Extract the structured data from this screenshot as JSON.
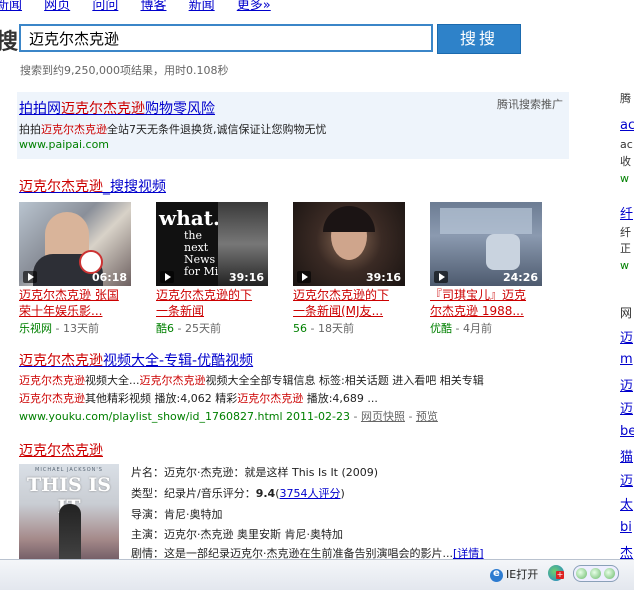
{
  "nav": [
    "新闻",
    "网页",
    "问问",
    "博客",
    "新闻",
    "更多»"
  ],
  "search": {
    "logo_char": "搜",
    "query": "迈克尔杰克逊",
    "button": "搜搜",
    "stats": "搜索到约9,250,000项结果，用时0.108秒"
  },
  "ad": {
    "title_pre": "拍拍网",
    "title_hl": "迈克尔杰克逊",
    "title_post": "购物零风险",
    "tag": "腾讯搜索推广",
    "desc_pre": "拍拍",
    "desc_hl": "迈克尔杰克逊",
    "desc_post": "全站7天无条件退换货,诚信保证让您购物无忧",
    "url": "www.paipai.com"
  },
  "video": {
    "title_hl": "迈克尔杰克逊",
    "title_post": "_搜搜视频",
    "items": [
      {
        "duration": "06:18",
        "cap1": "迈克尔杰克逊 张国",
        "cap2": "荣十年娱乐影...",
        "source": "乐视网",
        "age": " - 13天前"
      },
      {
        "duration": "39:16",
        "cap1": "迈克尔杰克逊的下",
        "cap2": "一条新闻",
        "source": "酷6",
        "age": " - 25天前"
      },
      {
        "duration": "39:16",
        "cap1": "迈克尔杰克逊的下",
        "cap2": "一条新闻(MJ友...",
        "source": "56",
        "age": " - 18天前"
      },
      {
        "duration": "24:26",
        "cap1": "『司琪宝儿』迈克",
        "cap2": "尔杰克逊  1988...",
        "source": "优酷",
        "age": " - 4月前"
      }
    ]
  },
  "youku": {
    "title_hl": "迈克尔杰克逊",
    "title_post": "视频大全-专辑-优酷视频",
    "l1a": "迈克尔杰克逊",
    "l1b": "视频大全...",
    "l1c": "迈克尔杰克逊",
    "l1d": "视频大全全部专辑信息 标签:相关话题 进入看吧 相关专辑",
    "l2a": "迈克尔杰克逊",
    "l2b": "其他精彩视频 播放:4,062 精彩",
    "l2c": "迈克尔杰克逊",
    "l2d": " 播放:4,689 ...",
    "url": "www.youku.com/playlist_show/id_1760827.html 2011-02-23",
    "sep": " - ",
    "cache": "网页快照",
    "sep2": " - ",
    "preview": "预览"
  },
  "movie": {
    "title": "迈克尔杰克逊",
    "poster_name": "MICHAEL JACKSON'S",
    "poster_title": "THIS IS IT",
    "row1": "片名：迈克尔·杰克逊：就是这样  This Is It  (2009)",
    "row2_pre": "类型：纪录片/音乐评分：",
    "row2_score": "9.4",
    "row2_paren_open": "(",
    "row2_link": "3754人评分",
    "row2_paren_close": ")",
    "row3": "导演：肯尼·奥特加",
    "row4": "主演：迈克尔·杰克逊  奥里安斯  肯尼·奥特加",
    "row5": "剧情：这是一部纪录迈克尔·杰克逊在生前准备告别演唱会的影片...",
    "row5_link": "[详情]"
  },
  "right": {
    "r1": "腾",
    "r2": "ac",
    "r3": "ac",
    "r4": "收",
    "r5": "w",
    "r6": "纤",
    "r7": "纤",
    "r8": "正",
    "r9": "w",
    "r10": "网",
    "r11": "迈",
    "r12": "m",
    "r13": "迈",
    "r14": "迈",
    "r15": "be",
    "r16": "猫",
    "r17": "迈",
    "r18": "太",
    "r19": "bi",
    "r20": "杰"
  },
  "status": {
    "ie_open": "IE打开"
  }
}
